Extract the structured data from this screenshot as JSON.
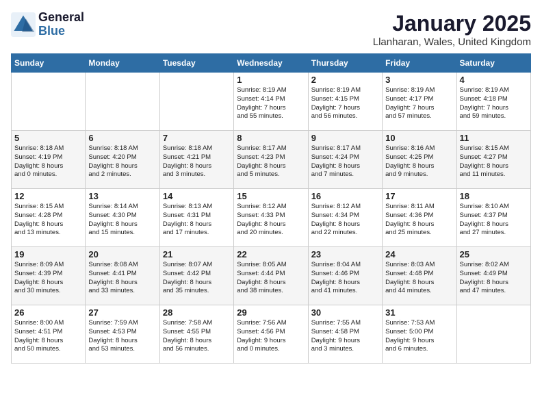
{
  "header": {
    "logo_line1": "General",
    "logo_line2": "Blue",
    "title": "January 2025",
    "subtitle": "Llanharan, Wales, United Kingdom"
  },
  "days_of_week": [
    "Sunday",
    "Monday",
    "Tuesday",
    "Wednesday",
    "Thursday",
    "Friday",
    "Saturday"
  ],
  "weeks": [
    [
      {
        "day": "",
        "info": ""
      },
      {
        "day": "",
        "info": ""
      },
      {
        "day": "",
        "info": ""
      },
      {
        "day": "1",
        "info": "Sunrise: 8:19 AM\nSunset: 4:14 PM\nDaylight: 7 hours\nand 55 minutes."
      },
      {
        "day": "2",
        "info": "Sunrise: 8:19 AM\nSunset: 4:15 PM\nDaylight: 7 hours\nand 56 minutes."
      },
      {
        "day": "3",
        "info": "Sunrise: 8:19 AM\nSunset: 4:17 PM\nDaylight: 7 hours\nand 57 minutes."
      },
      {
        "day": "4",
        "info": "Sunrise: 8:19 AM\nSunset: 4:18 PM\nDaylight: 7 hours\nand 59 minutes."
      }
    ],
    [
      {
        "day": "5",
        "info": "Sunrise: 8:18 AM\nSunset: 4:19 PM\nDaylight: 8 hours\nand 0 minutes."
      },
      {
        "day": "6",
        "info": "Sunrise: 8:18 AM\nSunset: 4:20 PM\nDaylight: 8 hours\nand 2 minutes."
      },
      {
        "day": "7",
        "info": "Sunrise: 8:18 AM\nSunset: 4:21 PM\nDaylight: 8 hours\nand 3 minutes."
      },
      {
        "day": "8",
        "info": "Sunrise: 8:17 AM\nSunset: 4:23 PM\nDaylight: 8 hours\nand 5 minutes."
      },
      {
        "day": "9",
        "info": "Sunrise: 8:17 AM\nSunset: 4:24 PM\nDaylight: 8 hours\nand 7 minutes."
      },
      {
        "day": "10",
        "info": "Sunrise: 8:16 AM\nSunset: 4:25 PM\nDaylight: 8 hours\nand 9 minutes."
      },
      {
        "day": "11",
        "info": "Sunrise: 8:15 AM\nSunset: 4:27 PM\nDaylight: 8 hours\nand 11 minutes."
      }
    ],
    [
      {
        "day": "12",
        "info": "Sunrise: 8:15 AM\nSunset: 4:28 PM\nDaylight: 8 hours\nand 13 minutes."
      },
      {
        "day": "13",
        "info": "Sunrise: 8:14 AM\nSunset: 4:30 PM\nDaylight: 8 hours\nand 15 minutes."
      },
      {
        "day": "14",
        "info": "Sunrise: 8:13 AM\nSunset: 4:31 PM\nDaylight: 8 hours\nand 17 minutes."
      },
      {
        "day": "15",
        "info": "Sunrise: 8:12 AM\nSunset: 4:33 PM\nDaylight: 8 hours\nand 20 minutes."
      },
      {
        "day": "16",
        "info": "Sunrise: 8:12 AM\nSunset: 4:34 PM\nDaylight: 8 hours\nand 22 minutes."
      },
      {
        "day": "17",
        "info": "Sunrise: 8:11 AM\nSunset: 4:36 PM\nDaylight: 8 hours\nand 25 minutes."
      },
      {
        "day": "18",
        "info": "Sunrise: 8:10 AM\nSunset: 4:37 PM\nDaylight: 8 hours\nand 27 minutes."
      }
    ],
    [
      {
        "day": "19",
        "info": "Sunrise: 8:09 AM\nSunset: 4:39 PM\nDaylight: 8 hours\nand 30 minutes."
      },
      {
        "day": "20",
        "info": "Sunrise: 8:08 AM\nSunset: 4:41 PM\nDaylight: 8 hours\nand 33 minutes."
      },
      {
        "day": "21",
        "info": "Sunrise: 8:07 AM\nSunset: 4:42 PM\nDaylight: 8 hours\nand 35 minutes."
      },
      {
        "day": "22",
        "info": "Sunrise: 8:05 AM\nSunset: 4:44 PM\nDaylight: 8 hours\nand 38 minutes."
      },
      {
        "day": "23",
        "info": "Sunrise: 8:04 AM\nSunset: 4:46 PM\nDaylight: 8 hours\nand 41 minutes."
      },
      {
        "day": "24",
        "info": "Sunrise: 8:03 AM\nSunset: 4:48 PM\nDaylight: 8 hours\nand 44 minutes."
      },
      {
        "day": "25",
        "info": "Sunrise: 8:02 AM\nSunset: 4:49 PM\nDaylight: 8 hours\nand 47 minutes."
      }
    ],
    [
      {
        "day": "26",
        "info": "Sunrise: 8:00 AM\nSunset: 4:51 PM\nDaylight: 8 hours\nand 50 minutes."
      },
      {
        "day": "27",
        "info": "Sunrise: 7:59 AM\nSunset: 4:53 PM\nDaylight: 8 hours\nand 53 minutes."
      },
      {
        "day": "28",
        "info": "Sunrise: 7:58 AM\nSunset: 4:55 PM\nDaylight: 8 hours\nand 56 minutes."
      },
      {
        "day": "29",
        "info": "Sunrise: 7:56 AM\nSunset: 4:56 PM\nDaylight: 9 hours\nand 0 minutes."
      },
      {
        "day": "30",
        "info": "Sunrise: 7:55 AM\nSunset: 4:58 PM\nDaylight: 9 hours\nand 3 minutes."
      },
      {
        "day": "31",
        "info": "Sunrise: 7:53 AM\nSunset: 5:00 PM\nDaylight: 9 hours\nand 6 minutes."
      },
      {
        "day": "",
        "info": ""
      }
    ]
  ]
}
